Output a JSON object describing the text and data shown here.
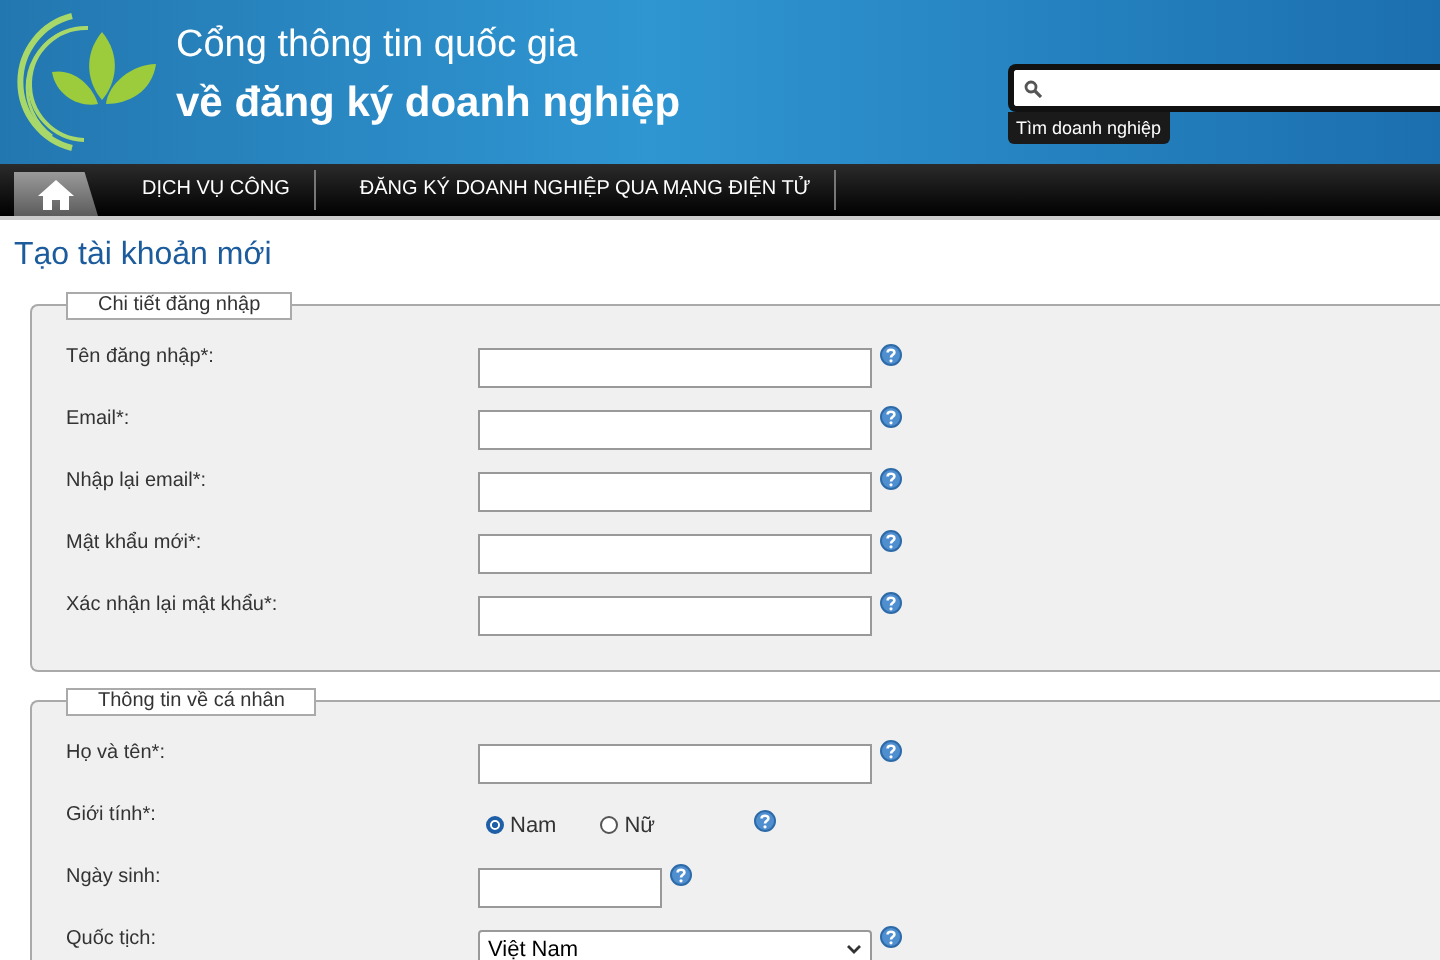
{
  "header": {
    "title_line1": "Cổng thông tin quốc gia",
    "title_line2": "về đăng ký doanh nghiệp",
    "search_caption": "Tìm doanh nghiệp"
  },
  "nav": {
    "home_selected": true,
    "items": [
      "DỊCH VỤ CÔNG",
      "ĐĂNG KÝ DOANH NGHIỆP QUA MẠNG ĐIỆN TỬ"
    ]
  },
  "page_title": "Tạo tài khoản mới",
  "sections": [
    {
      "legend": "Chi tiết đăng nhập",
      "fields": [
        {
          "kind": "text",
          "label": "Tên đăng nhập*:"
        },
        {
          "kind": "text",
          "label": "Email*:"
        },
        {
          "kind": "text",
          "label": "Nhập lại email*:"
        },
        {
          "kind": "text",
          "label": "Mật khẩu mới*:"
        },
        {
          "kind": "text",
          "label": "Xác nhận lại mật khẩu*:"
        }
      ]
    },
    {
      "legend": "Thông tin về cá nhân",
      "fields": [
        {
          "kind": "text",
          "label": "Họ và tên*:"
        },
        {
          "kind": "radio",
          "label": "Giới tính*:",
          "options": [
            {
              "label": "Nam",
              "selected": true
            },
            {
              "label": "Nữ",
              "selected": false
            }
          ]
        },
        {
          "kind": "short",
          "label": "Ngày sinh:"
        },
        {
          "kind": "select",
          "label": "Quốc tịch:",
          "value": "Việt Nam"
        }
      ]
    }
  ]
}
